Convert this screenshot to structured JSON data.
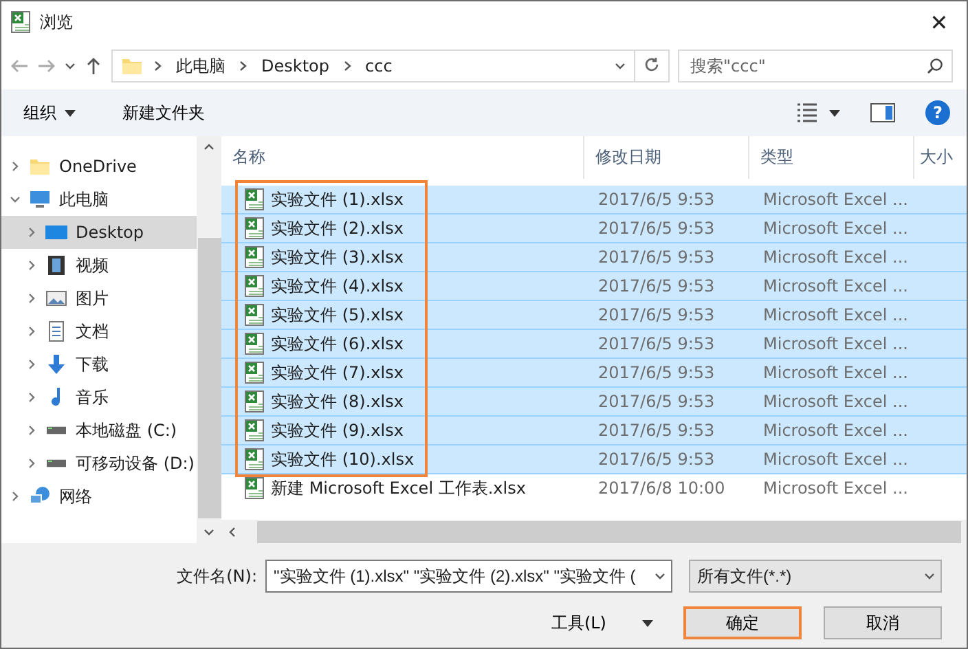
{
  "window": {
    "title": "浏览",
    "close": "✕"
  },
  "address": {
    "crumbs": [
      "此电脑",
      "Desktop",
      "ccc"
    ],
    "search_placeholder": "搜索\"ccc\""
  },
  "toolbar": {
    "organize": "组织",
    "new_folder": "新建文件夹",
    "help": "?"
  },
  "nav": [
    {
      "label": "OneDrive",
      "kind": "folder",
      "expanded": false,
      "selected": false
    },
    {
      "label": "此电脑",
      "kind": "computer",
      "expanded": true,
      "selected": false,
      "children": [
        {
          "label": "Desktop",
          "kind": "desktop",
          "expanded": false,
          "selected": true
        },
        {
          "label": "视频",
          "kind": "video",
          "expanded": false,
          "selected": false
        },
        {
          "label": "图片",
          "kind": "image",
          "expanded": false,
          "selected": false
        },
        {
          "label": "文档",
          "kind": "document",
          "expanded": false,
          "selected": false
        },
        {
          "label": "下载",
          "kind": "download",
          "expanded": false,
          "selected": false
        },
        {
          "label": "音乐",
          "kind": "music",
          "expanded": false,
          "selected": false
        },
        {
          "label": "本地磁盘 (C:)",
          "kind": "drive",
          "expanded": false,
          "selected": false
        },
        {
          "label": "可移动设备 (D:)",
          "kind": "drive",
          "expanded": false,
          "selected": false
        }
      ]
    },
    {
      "label": "网络",
      "kind": "network",
      "expanded": false,
      "selected": false
    }
  ],
  "table": {
    "columns": [
      "名称",
      "修改日期",
      "类型",
      "大小"
    ],
    "selection_outlined": true,
    "rows": [
      {
        "name": "实验文件 (1).xlsx",
        "date": "2017/6/5 9:53",
        "type": "Microsoft Excel ...",
        "selected": true
      },
      {
        "name": "实验文件 (2).xlsx",
        "date": "2017/6/5 9:53",
        "type": "Microsoft Excel ...",
        "selected": true
      },
      {
        "name": "实验文件 (3).xlsx",
        "date": "2017/6/5 9:53",
        "type": "Microsoft Excel ...",
        "selected": true
      },
      {
        "name": "实验文件 (4).xlsx",
        "date": "2017/6/5 9:53",
        "type": "Microsoft Excel ...",
        "selected": true
      },
      {
        "name": "实验文件 (5).xlsx",
        "date": "2017/6/5 9:53",
        "type": "Microsoft Excel ...",
        "selected": true
      },
      {
        "name": "实验文件 (6).xlsx",
        "date": "2017/6/5 9:53",
        "type": "Microsoft Excel ...",
        "selected": true
      },
      {
        "name": "实验文件 (7).xlsx",
        "date": "2017/6/5 9:53",
        "type": "Microsoft Excel ...",
        "selected": true
      },
      {
        "name": "实验文件 (8).xlsx",
        "date": "2017/6/5 9:53",
        "type": "Microsoft Excel ...",
        "selected": true
      },
      {
        "name": "实验文件 (9).xlsx",
        "date": "2017/6/5 9:53",
        "type": "Microsoft Excel ...",
        "selected": true
      },
      {
        "name": "实验文件 (10).xlsx",
        "date": "2017/6/5 9:53",
        "type": "Microsoft Excel ...",
        "selected": true
      },
      {
        "name": "新建 Microsoft Excel 工作表.xlsx",
        "date": "2017/6/8 10:00",
        "type": "Microsoft Excel ...",
        "selected": false
      }
    ]
  },
  "footer": {
    "filename_label": "文件名(N):",
    "filename_value": "\"实验文件 (1).xlsx\" \"实验文件 (2).xlsx\" \"实验文件 (",
    "filter": "所有文件(*.*)",
    "tools": "工具(L)",
    "buttons": [
      {
        "label": "确定",
        "outlined": true
      },
      {
        "label": "取消",
        "outlined": false
      }
    ]
  }
}
